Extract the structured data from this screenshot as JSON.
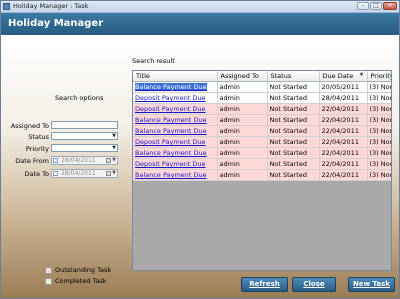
{
  "window": {
    "title": "Holiday Manager : Task",
    "minimize": "–",
    "maximize": "□",
    "close": "✕"
  },
  "header": {
    "title": "Holiday Manager"
  },
  "search_options": {
    "heading": "Search options",
    "assigned_to": {
      "label": "Assigned To",
      "value": ""
    },
    "status": {
      "label": "Status",
      "value": ""
    },
    "priority": {
      "label": "Priority",
      "value": ""
    },
    "date_from": {
      "label": "Date From",
      "value": "28/04/2011"
    },
    "date_to": {
      "label": "Date To",
      "value": "28/04/2011"
    }
  },
  "results": {
    "heading": "Search result",
    "columns": [
      "Title",
      "Assigned To",
      "Status",
      "Due Date",
      "Priority"
    ],
    "rows": [
      {
        "title": "Balance Payment Due",
        "assigned": "admin",
        "status": "Not Started",
        "due": "20/05/2011",
        "priority": "(3) Normal"
      },
      {
        "title": "Deposit Payment Due",
        "assigned": "admin",
        "status": "Not Started",
        "due": "28/04/2011",
        "priority": "(3) Normal"
      },
      {
        "title": "Deposit Payment Due",
        "assigned": "admin",
        "status": "Not Started",
        "due": "22/04/2011",
        "priority": "(3) Normal"
      },
      {
        "title": "Balance Payment Due",
        "assigned": "admin",
        "status": "Not Started",
        "due": "22/04/2011",
        "priority": "(3) Normal"
      },
      {
        "title": "Balance Payment Due",
        "assigned": "admin",
        "status": "Not Started",
        "due": "22/04/2011",
        "priority": "(3) Normal"
      },
      {
        "title": "Deposit Payment Due",
        "assigned": "admin",
        "status": "Not Started",
        "due": "22/04/2011",
        "priority": "(3) Normal"
      },
      {
        "title": "Balance Payment Due",
        "assigned": "admin",
        "status": "Not Started",
        "due": "22/04/2011",
        "priority": "(3) Normal"
      },
      {
        "title": "Deposit Payment Due",
        "assigned": "admin",
        "status": "Not Started",
        "due": "22/04/2011",
        "priority": "(3) Normal"
      },
      {
        "title": "Balance Payment Due",
        "assigned": "admin",
        "status": "Not Started",
        "due": "22/04/2011",
        "priority": "(3) Normal"
      }
    ]
  },
  "legend": {
    "outstanding": {
      "label": "Outstanding Task",
      "color": "#ffd8d8"
    },
    "completed": {
      "label": "Completed Task",
      "color": "#e6f3cf"
    }
  },
  "buttons": {
    "refresh": "Refresh",
    "close": "Close",
    "new_task": "New Task"
  },
  "colors": {
    "header": "#2f6a92",
    "outstanding_row": "#ffd8d8",
    "selection": "#3a6fd8"
  }
}
